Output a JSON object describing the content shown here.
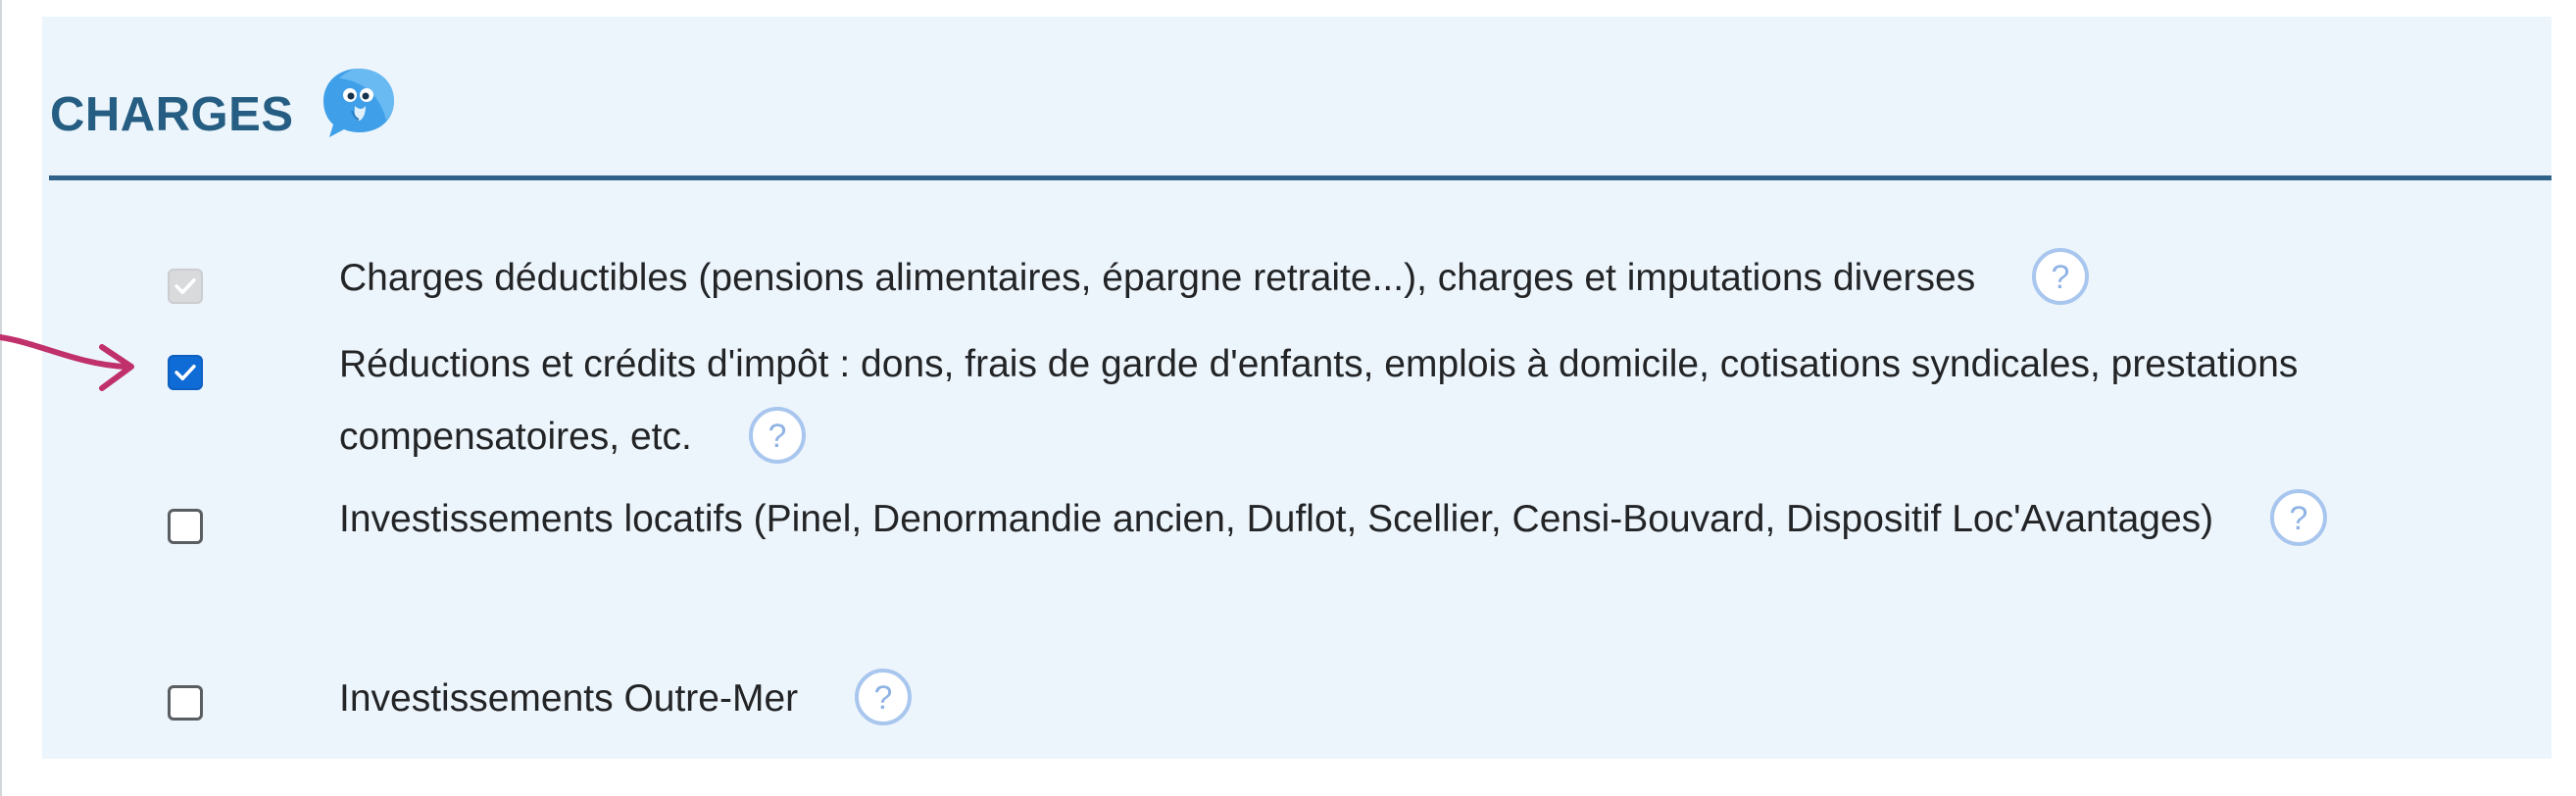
{
  "section": {
    "title": "CHARGES"
  },
  "items": [
    {
      "label": "Charges déductibles (pensions alimentaires, épargne retraite...), charges et imputations diverses",
      "state": "checked-disabled"
    },
    {
      "label": "Réductions et crédits d'impôt : dons, frais de garde d'enfants, emplois à domicile, cotisations syndicales, prestations compensatoires, etc.",
      "state": "checked"
    },
    {
      "label": "Investissements locatifs (Pinel, Denormandie ancien, Duflot, Scellier, Censi-Bouvard, Dispositif Loc'Avantages)",
      "state": "unchecked"
    },
    {
      "label": "Investissements Outre-Mer",
      "state": "unchecked"
    }
  ],
  "icons": {
    "mascot": "mascot-bubble-icon",
    "help": "question-mark-icon",
    "annotation": "curved-arrow-icon"
  },
  "colors": {
    "title": "#255e82",
    "rule": "#2f6388",
    "panel_background": "#edf5fc",
    "checkbox_checked": "#0f6bd6",
    "annotation_arrow": "#c0306a"
  }
}
